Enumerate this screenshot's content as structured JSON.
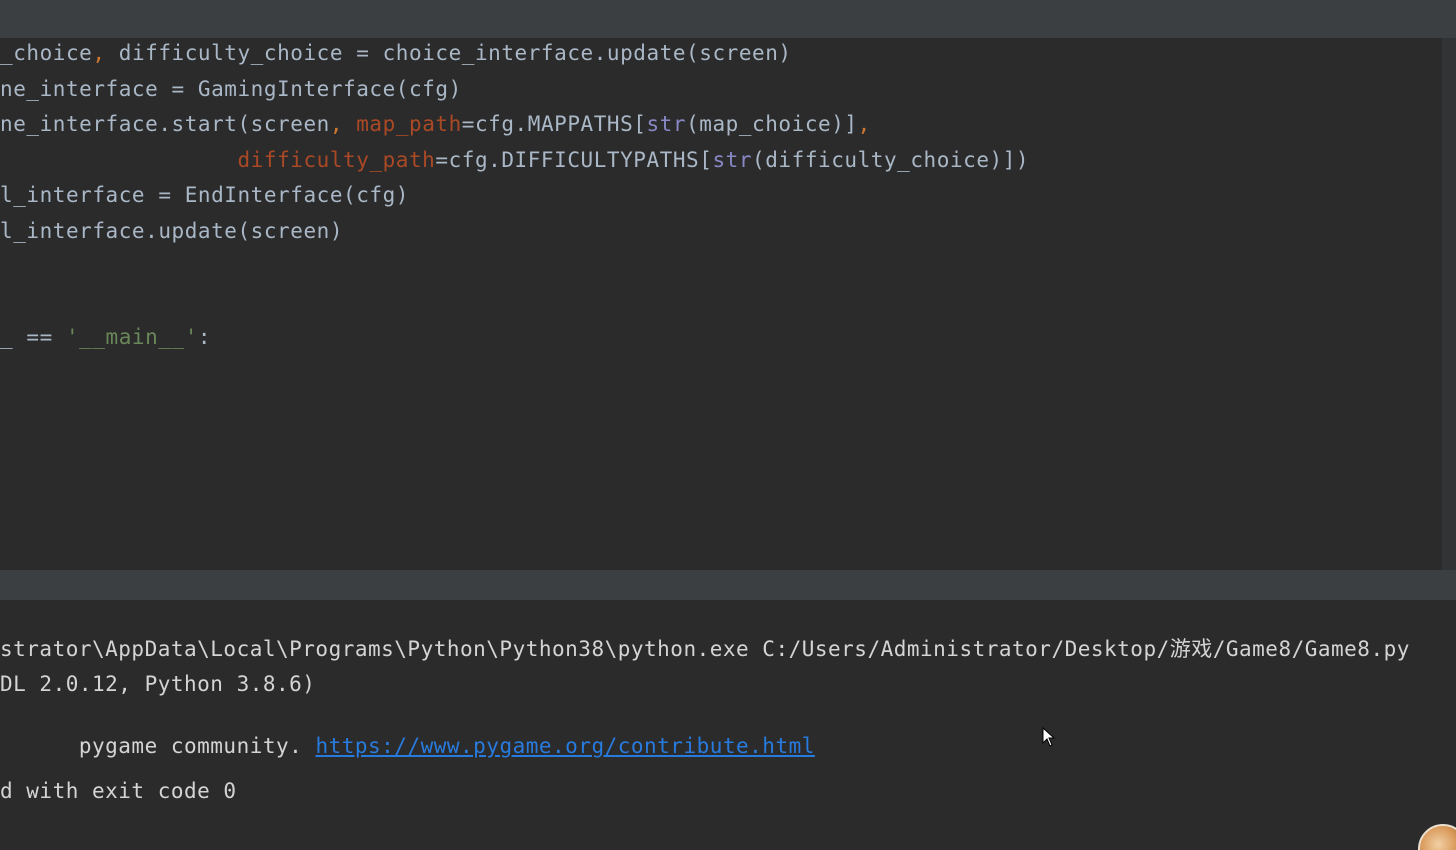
{
  "editor": {
    "lines": [
      {
        "parts": [
          {
            "t": "_choice",
            "c": "plain"
          },
          {
            "t": ",",
            "c": "punct"
          },
          {
            "t": " difficulty_choice = choice_interface.update(screen)",
            "c": "plain"
          }
        ]
      },
      {
        "parts": [
          {
            "t": "ne_interface = GamingInterface(cfg)",
            "c": "plain"
          }
        ]
      },
      {
        "parts": [
          {
            "t": "ne_interface.start(screen",
            "c": "plain"
          },
          {
            "t": ",",
            "c": "punct"
          },
          {
            "t": " ",
            "c": "plain"
          },
          {
            "t": "map_path",
            "c": "param"
          },
          {
            "t": "=cfg.MAPPATHS[",
            "c": "plain"
          },
          {
            "t": "str",
            "c": "builtin"
          },
          {
            "t": "(map_choice)]",
            "c": "plain"
          },
          {
            "t": ",",
            "c": "punct"
          }
        ]
      },
      {
        "parts": [
          {
            "t": "                  ",
            "c": "plain"
          },
          {
            "t": "difficulty_path",
            "c": "param"
          },
          {
            "t": "=cfg.DIFFICULTYPATHS[",
            "c": "plain"
          },
          {
            "t": "str",
            "c": "builtin"
          },
          {
            "t": "(difficulty_choice)])",
            "c": "plain"
          }
        ]
      },
      {
        "parts": [
          {
            "t": "l_interface = EndInterface(cfg)",
            "c": "plain"
          }
        ]
      },
      {
        "parts": [
          {
            "t": "l_interface.update(screen)",
            "c": "plain"
          }
        ]
      },
      {
        "parts": [
          {
            "t": "_ == ",
            "c": "plain"
          },
          {
            "t": "'__main__'",
            "c": "str"
          },
          {
            "t": ":",
            "c": "plain"
          }
        ]
      }
    ]
  },
  "console": {
    "line1": "strator\\AppData\\Local\\Programs\\Python\\Python38\\python.exe C:/Users/Administrator/Desktop/游戏/Game8/Game8.py",
    "line2": "DL 2.0.12, Python 3.8.6)",
    "line3_prefix": "pygame community. ",
    "line3_link": "https://www.pygame.org/contribute.html",
    "line4": "d with exit code 0"
  },
  "colors": {
    "background": "#2b2b2b",
    "panel": "#3c3f41",
    "code_default": "#a9b7c6",
    "keyword": "#cc7832",
    "param": "#aa4926",
    "builtin": "#8888c6",
    "string": "#6a8759",
    "link": "#287bde"
  },
  "icons": {
    "cursor": "mouse-pointer-icon",
    "avatar": "user-avatar"
  }
}
